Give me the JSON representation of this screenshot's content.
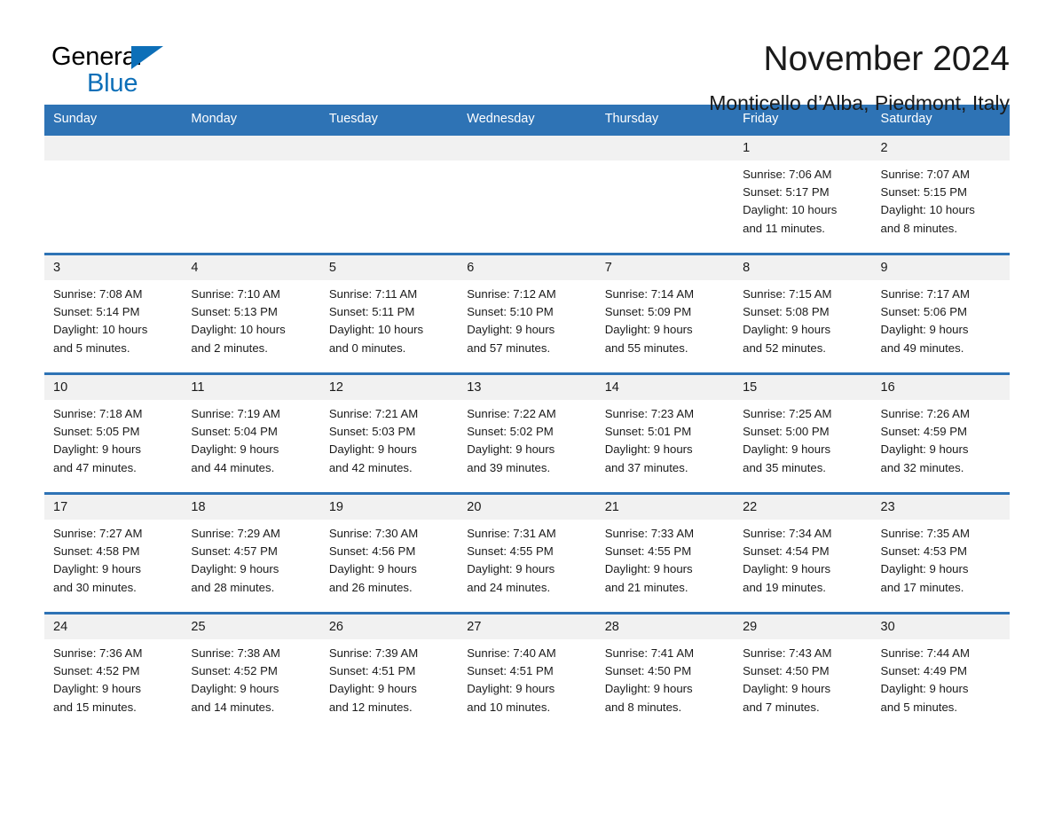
{
  "brand": {
    "name_dark": "General",
    "name_light": "Blue",
    "triangle_icon": "blue-triangle-icon",
    "accent_color": "#0d6fb8"
  },
  "header": {
    "month_title": "November 2024",
    "location": "Monticello d’Alba, Piedmont, Italy"
  },
  "theme": {
    "header_blue": "#2e73b5",
    "daynum_band": "#f1f1f1",
    "text": "#1a1a1a"
  },
  "calendar": {
    "weekday_headers": [
      "Sunday",
      "Monday",
      "Tuesday",
      "Wednesday",
      "Thursday",
      "Friday",
      "Saturday"
    ],
    "weeks": [
      [
        {
          "day": "",
          "sunrise": "",
          "sunset": "",
          "daylight": "",
          "daylight2": ""
        },
        {
          "day": "",
          "sunrise": "",
          "sunset": "",
          "daylight": "",
          "daylight2": ""
        },
        {
          "day": "",
          "sunrise": "",
          "sunset": "",
          "daylight": "",
          "daylight2": ""
        },
        {
          "day": "",
          "sunrise": "",
          "sunset": "",
          "daylight": "",
          "daylight2": ""
        },
        {
          "day": "",
          "sunrise": "",
          "sunset": "",
          "daylight": "",
          "daylight2": ""
        },
        {
          "day": "1",
          "sunrise": "Sunrise: 7:06 AM",
          "sunset": "Sunset: 5:17 PM",
          "daylight": "Daylight: 10 hours",
          "daylight2": "and 11 minutes."
        },
        {
          "day": "2",
          "sunrise": "Sunrise: 7:07 AM",
          "sunset": "Sunset: 5:15 PM",
          "daylight": "Daylight: 10 hours",
          "daylight2": "and 8 minutes."
        }
      ],
      [
        {
          "day": "3",
          "sunrise": "Sunrise: 7:08 AM",
          "sunset": "Sunset: 5:14 PM",
          "daylight": "Daylight: 10 hours",
          "daylight2": "and 5 minutes."
        },
        {
          "day": "4",
          "sunrise": "Sunrise: 7:10 AM",
          "sunset": "Sunset: 5:13 PM",
          "daylight": "Daylight: 10 hours",
          "daylight2": "and 2 minutes."
        },
        {
          "day": "5",
          "sunrise": "Sunrise: 7:11 AM",
          "sunset": "Sunset: 5:11 PM",
          "daylight": "Daylight: 10 hours",
          "daylight2": "and 0 minutes."
        },
        {
          "day": "6",
          "sunrise": "Sunrise: 7:12 AM",
          "sunset": "Sunset: 5:10 PM",
          "daylight": "Daylight: 9 hours",
          "daylight2": "and 57 minutes."
        },
        {
          "day": "7",
          "sunrise": "Sunrise: 7:14 AM",
          "sunset": "Sunset: 5:09 PM",
          "daylight": "Daylight: 9 hours",
          "daylight2": "and 55 minutes."
        },
        {
          "day": "8",
          "sunrise": "Sunrise: 7:15 AM",
          "sunset": "Sunset: 5:08 PM",
          "daylight": "Daylight: 9 hours",
          "daylight2": "and 52 minutes."
        },
        {
          "day": "9",
          "sunrise": "Sunrise: 7:17 AM",
          "sunset": "Sunset: 5:06 PM",
          "daylight": "Daylight: 9 hours",
          "daylight2": "and 49 minutes."
        }
      ],
      [
        {
          "day": "10",
          "sunrise": "Sunrise: 7:18 AM",
          "sunset": "Sunset: 5:05 PM",
          "daylight": "Daylight: 9 hours",
          "daylight2": "and 47 minutes."
        },
        {
          "day": "11",
          "sunrise": "Sunrise: 7:19 AM",
          "sunset": "Sunset: 5:04 PM",
          "daylight": "Daylight: 9 hours",
          "daylight2": "and 44 minutes."
        },
        {
          "day": "12",
          "sunrise": "Sunrise: 7:21 AM",
          "sunset": "Sunset: 5:03 PM",
          "daylight": "Daylight: 9 hours",
          "daylight2": "and 42 minutes."
        },
        {
          "day": "13",
          "sunrise": "Sunrise: 7:22 AM",
          "sunset": "Sunset: 5:02 PM",
          "daylight": "Daylight: 9 hours",
          "daylight2": "and 39 minutes."
        },
        {
          "day": "14",
          "sunrise": "Sunrise: 7:23 AM",
          "sunset": "Sunset: 5:01 PM",
          "daylight": "Daylight: 9 hours",
          "daylight2": "and 37 minutes."
        },
        {
          "day": "15",
          "sunrise": "Sunrise: 7:25 AM",
          "sunset": "Sunset: 5:00 PM",
          "daylight": "Daylight: 9 hours",
          "daylight2": "and 35 minutes."
        },
        {
          "day": "16",
          "sunrise": "Sunrise: 7:26 AM",
          "sunset": "Sunset: 4:59 PM",
          "daylight": "Daylight: 9 hours",
          "daylight2": "and 32 minutes."
        }
      ],
      [
        {
          "day": "17",
          "sunrise": "Sunrise: 7:27 AM",
          "sunset": "Sunset: 4:58 PM",
          "daylight": "Daylight: 9 hours",
          "daylight2": "and 30 minutes."
        },
        {
          "day": "18",
          "sunrise": "Sunrise: 7:29 AM",
          "sunset": "Sunset: 4:57 PM",
          "daylight": "Daylight: 9 hours",
          "daylight2": "and 28 minutes."
        },
        {
          "day": "19",
          "sunrise": "Sunrise: 7:30 AM",
          "sunset": "Sunset: 4:56 PM",
          "daylight": "Daylight: 9 hours",
          "daylight2": "and 26 minutes."
        },
        {
          "day": "20",
          "sunrise": "Sunrise: 7:31 AM",
          "sunset": "Sunset: 4:55 PM",
          "daylight": "Daylight: 9 hours",
          "daylight2": "and 24 minutes."
        },
        {
          "day": "21",
          "sunrise": "Sunrise: 7:33 AM",
          "sunset": "Sunset: 4:55 PM",
          "daylight": "Daylight: 9 hours",
          "daylight2": "and 21 minutes."
        },
        {
          "day": "22",
          "sunrise": "Sunrise: 7:34 AM",
          "sunset": "Sunset: 4:54 PM",
          "daylight": "Daylight: 9 hours",
          "daylight2": "and 19 minutes."
        },
        {
          "day": "23",
          "sunrise": "Sunrise: 7:35 AM",
          "sunset": "Sunset: 4:53 PM",
          "daylight": "Daylight: 9 hours",
          "daylight2": "and 17 minutes."
        }
      ],
      [
        {
          "day": "24",
          "sunrise": "Sunrise: 7:36 AM",
          "sunset": "Sunset: 4:52 PM",
          "daylight": "Daylight: 9 hours",
          "daylight2": "and 15 minutes."
        },
        {
          "day": "25",
          "sunrise": "Sunrise: 7:38 AM",
          "sunset": "Sunset: 4:52 PM",
          "daylight": "Daylight: 9 hours",
          "daylight2": "and 14 minutes."
        },
        {
          "day": "26",
          "sunrise": "Sunrise: 7:39 AM",
          "sunset": "Sunset: 4:51 PM",
          "daylight": "Daylight: 9 hours",
          "daylight2": "and 12 minutes."
        },
        {
          "day": "27",
          "sunrise": "Sunrise: 7:40 AM",
          "sunset": "Sunset: 4:51 PM",
          "daylight": "Daylight: 9 hours",
          "daylight2": "and 10 minutes."
        },
        {
          "day": "28",
          "sunrise": "Sunrise: 7:41 AM",
          "sunset": "Sunset: 4:50 PM",
          "daylight": "Daylight: 9 hours",
          "daylight2": "and 8 minutes."
        },
        {
          "day": "29",
          "sunrise": "Sunrise: 7:43 AM",
          "sunset": "Sunset: 4:50 PM",
          "daylight": "Daylight: 9 hours",
          "daylight2": "and 7 minutes."
        },
        {
          "day": "30",
          "sunrise": "Sunrise: 7:44 AM",
          "sunset": "Sunset: 4:49 PM",
          "daylight": "Daylight: 9 hours",
          "daylight2": "and 5 minutes."
        }
      ]
    ]
  }
}
